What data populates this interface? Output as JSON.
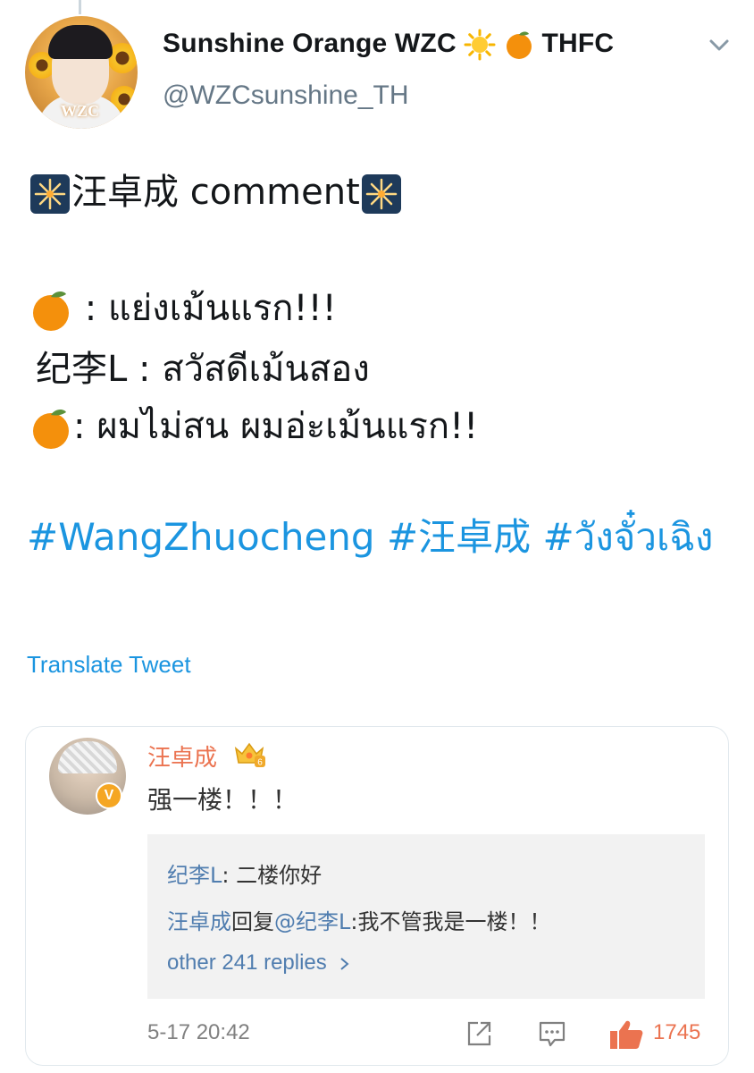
{
  "author": {
    "display_name": "Sunshine Orange WZC",
    "name_suffix": "THFC",
    "handle": "@WZCsunshine_TH",
    "avatar_logo": "WZC"
  },
  "tweet": {
    "title_word": "汪卓成 comment",
    "line1": ": แย่งเม้นแรก!!!",
    "line2": "纪李L : สวัสดีเม้นสอง",
    "line3": ": ผมไม่สน ผมอ่ะเม้นแรก!!",
    "hashtags": "#WangZhuocheng #汪卓成 #วังจั๋วเฉิง",
    "translate_label": "Translate Tweet"
  },
  "card": {
    "commenter_name": "汪卓成",
    "crown_level": "6",
    "comment_text": "强一楼！！！",
    "reply1_name": "纪李L",
    "reply1_text": ": 二楼你好",
    "reply2_name": "汪卓成",
    "reply2_mid": "回复",
    "reply2_mention": "@纪李L",
    "reply2_text": ":我不管我是一楼！！",
    "more_replies": "other 241 replies",
    "timestamp": "5-17 20:42",
    "like_count": "1745",
    "accent_color": "#eb7350",
    "link_color": "#507daf"
  },
  "icons": [
    "fireworks-icon",
    "tangerine-icon",
    "sun-icon",
    "chevron-down-icon",
    "crown-icon",
    "share-icon",
    "comment-icon",
    "thumbs-up-icon",
    "verified-v-icon"
  ]
}
